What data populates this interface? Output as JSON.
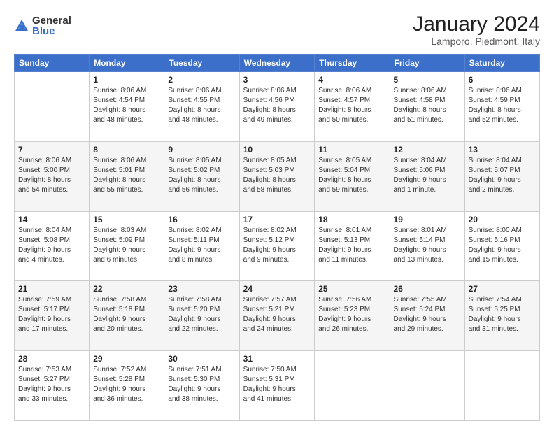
{
  "header": {
    "logo_general": "General",
    "logo_blue": "Blue",
    "title": "January 2024",
    "subtitle": "Lamporo, Piedmont, Italy"
  },
  "weekdays": [
    "Sunday",
    "Monday",
    "Tuesday",
    "Wednesday",
    "Thursday",
    "Friday",
    "Saturday"
  ],
  "weeks": [
    [
      {
        "day": "",
        "info": ""
      },
      {
        "day": "1",
        "info": "Sunrise: 8:06 AM\nSunset: 4:54 PM\nDaylight: 8 hours\nand 48 minutes."
      },
      {
        "day": "2",
        "info": "Sunrise: 8:06 AM\nSunset: 4:55 PM\nDaylight: 8 hours\nand 48 minutes."
      },
      {
        "day": "3",
        "info": "Sunrise: 8:06 AM\nSunset: 4:56 PM\nDaylight: 8 hours\nand 49 minutes."
      },
      {
        "day": "4",
        "info": "Sunrise: 8:06 AM\nSunset: 4:57 PM\nDaylight: 8 hours\nand 50 minutes."
      },
      {
        "day": "5",
        "info": "Sunrise: 8:06 AM\nSunset: 4:58 PM\nDaylight: 8 hours\nand 51 minutes."
      },
      {
        "day": "6",
        "info": "Sunrise: 8:06 AM\nSunset: 4:59 PM\nDaylight: 8 hours\nand 52 minutes."
      }
    ],
    [
      {
        "day": "7",
        "info": "Sunrise: 8:06 AM\nSunset: 5:00 PM\nDaylight: 8 hours\nand 54 minutes."
      },
      {
        "day": "8",
        "info": "Sunrise: 8:06 AM\nSunset: 5:01 PM\nDaylight: 8 hours\nand 55 minutes."
      },
      {
        "day": "9",
        "info": "Sunrise: 8:05 AM\nSunset: 5:02 PM\nDaylight: 8 hours\nand 56 minutes."
      },
      {
        "day": "10",
        "info": "Sunrise: 8:05 AM\nSunset: 5:03 PM\nDaylight: 8 hours\nand 58 minutes."
      },
      {
        "day": "11",
        "info": "Sunrise: 8:05 AM\nSunset: 5:04 PM\nDaylight: 8 hours\nand 59 minutes."
      },
      {
        "day": "12",
        "info": "Sunrise: 8:04 AM\nSunset: 5:06 PM\nDaylight: 9 hours\nand 1 minute."
      },
      {
        "day": "13",
        "info": "Sunrise: 8:04 AM\nSunset: 5:07 PM\nDaylight: 9 hours\nand 2 minutes."
      }
    ],
    [
      {
        "day": "14",
        "info": "Sunrise: 8:04 AM\nSunset: 5:08 PM\nDaylight: 9 hours\nand 4 minutes."
      },
      {
        "day": "15",
        "info": "Sunrise: 8:03 AM\nSunset: 5:09 PM\nDaylight: 9 hours\nand 6 minutes."
      },
      {
        "day": "16",
        "info": "Sunrise: 8:02 AM\nSunset: 5:11 PM\nDaylight: 9 hours\nand 8 minutes."
      },
      {
        "day": "17",
        "info": "Sunrise: 8:02 AM\nSunset: 5:12 PM\nDaylight: 9 hours\nand 9 minutes."
      },
      {
        "day": "18",
        "info": "Sunrise: 8:01 AM\nSunset: 5:13 PM\nDaylight: 9 hours\nand 11 minutes."
      },
      {
        "day": "19",
        "info": "Sunrise: 8:01 AM\nSunset: 5:14 PM\nDaylight: 9 hours\nand 13 minutes."
      },
      {
        "day": "20",
        "info": "Sunrise: 8:00 AM\nSunset: 5:16 PM\nDaylight: 9 hours\nand 15 minutes."
      }
    ],
    [
      {
        "day": "21",
        "info": "Sunrise: 7:59 AM\nSunset: 5:17 PM\nDaylight: 9 hours\nand 17 minutes."
      },
      {
        "day": "22",
        "info": "Sunrise: 7:58 AM\nSunset: 5:18 PM\nDaylight: 9 hours\nand 20 minutes."
      },
      {
        "day": "23",
        "info": "Sunrise: 7:58 AM\nSunset: 5:20 PM\nDaylight: 9 hours\nand 22 minutes."
      },
      {
        "day": "24",
        "info": "Sunrise: 7:57 AM\nSunset: 5:21 PM\nDaylight: 9 hours\nand 24 minutes."
      },
      {
        "day": "25",
        "info": "Sunrise: 7:56 AM\nSunset: 5:23 PM\nDaylight: 9 hours\nand 26 minutes."
      },
      {
        "day": "26",
        "info": "Sunrise: 7:55 AM\nSunset: 5:24 PM\nDaylight: 9 hours\nand 29 minutes."
      },
      {
        "day": "27",
        "info": "Sunrise: 7:54 AM\nSunset: 5:25 PM\nDaylight: 9 hours\nand 31 minutes."
      }
    ],
    [
      {
        "day": "28",
        "info": "Sunrise: 7:53 AM\nSunset: 5:27 PM\nDaylight: 9 hours\nand 33 minutes."
      },
      {
        "day": "29",
        "info": "Sunrise: 7:52 AM\nSunset: 5:28 PM\nDaylight: 9 hours\nand 36 minutes."
      },
      {
        "day": "30",
        "info": "Sunrise: 7:51 AM\nSunset: 5:30 PM\nDaylight: 9 hours\nand 38 minutes."
      },
      {
        "day": "31",
        "info": "Sunrise: 7:50 AM\nSunset: 5:31 PM\nDaylight: 9 hours\nand 41 minutes."
      },
      {
        "day": "",
        "info": ""
      },
      {
        "day": "",
        "info": ""
      },
      {
        "day": "",
        "info": ""
      }
    ]
  ]
}
